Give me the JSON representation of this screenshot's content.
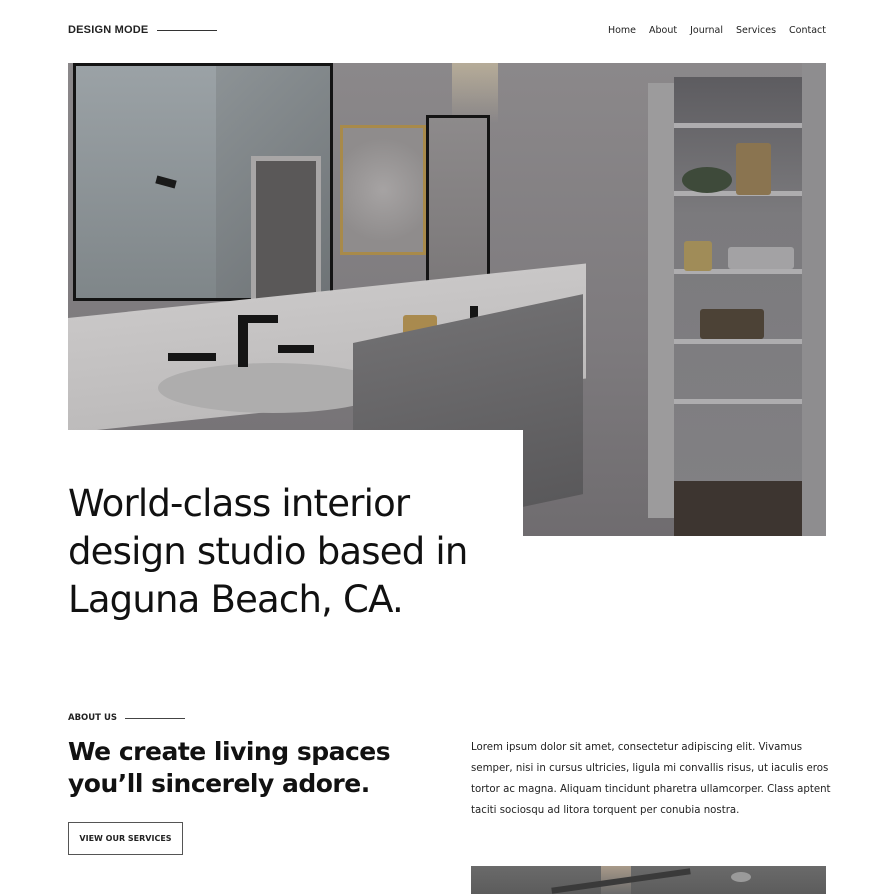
{
  "header": {
    "logo": "DESIGN MODE",
    "nav": [
      "Home",
      "About",
      "Journal",
      "Services",
      "Contact"
    ]
  },
  "hero": {
    "image_alt": "Modern bathroom with double vanity, black fixtures and open shelving",
    "title": "World-class interior design studio based in Laguna Beach, CA."
  },
  "about": {
    "label": "ABOUT US",
    "title": "We create living spaces you’ll sincerely adore.",
    "button": "VIEW OUR SERVICES",
    "body": "Lorem ipsum dolor sit amet, consectetur adipiscing elit. Vivamus semper, nisi in cursus ultricies, ligula mi convallis risus, ut iaculis eros tortor ac magna. Aliquam tincidunt pharetra ullamcorper. Class aptent taciti sociosqu ad litora torquent per conubia nostra."
  },
  "bottom_image": {
    "image_alt": "Room with ceiling fan"
  }
}
